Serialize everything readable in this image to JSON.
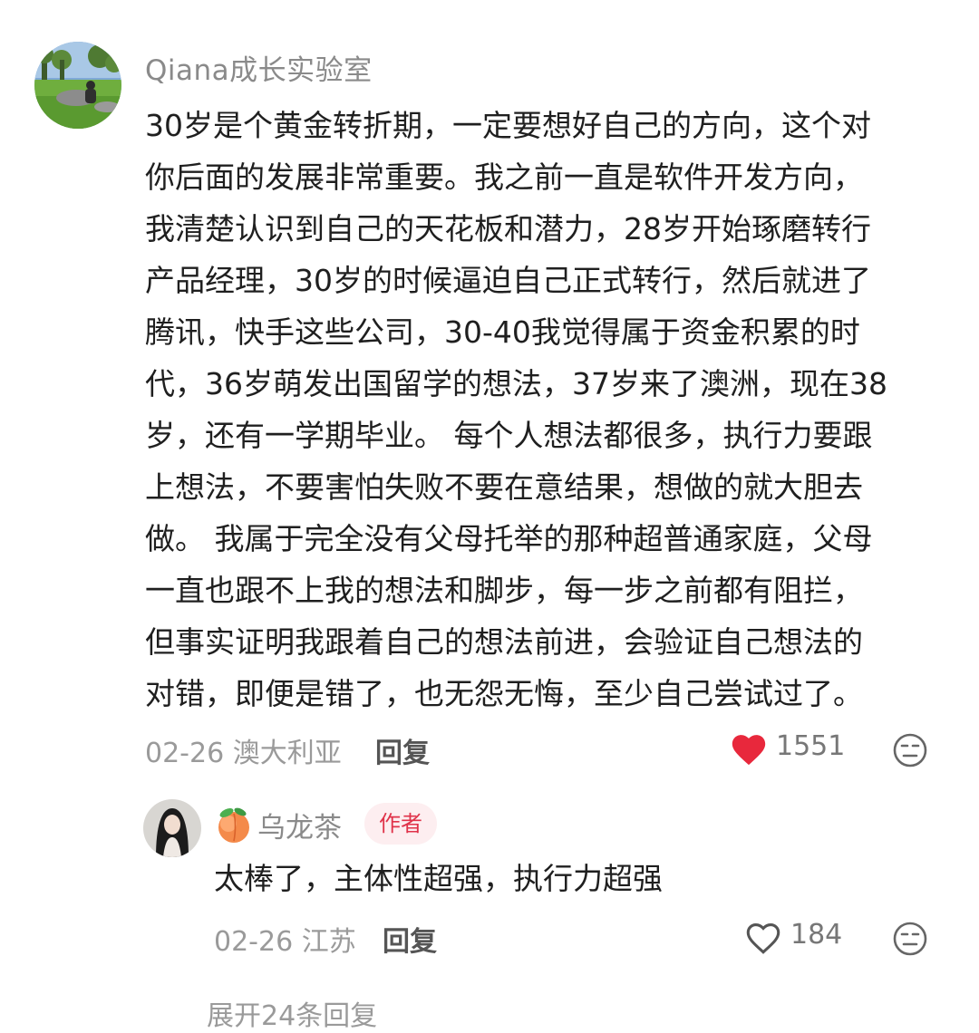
{
  "comment": {
    "username": "Qiana成长实验室",
    "body_lines": [
      "30岁是个黄金转折期，一定要想好自己的方向，这个对",
      "你后面的发展非常重要。我之前一直是软件开发方向，",
      "我清楚认识到自己的天花板和潜力，28岁开始琢磨转行",
      "产品经理，30岁的时候逼迫自己正式转行，然后就进了",
      "腾讯，快手这些公司，30-40我觉得属于资金积累的时",
      "代，36岁萌发出国留学的想法，37岁来了澳洲，现在38",
      "岁，还有一学期毕业。 每个人想法都很多，执行力要跟",
      "上想法，不要害怕失败不要在意结果，想做的就大胆去",
      "做。 我属于完全没有父母托举的那种超普通家庭，父母",
      "一直也跟不上我的想法和脚步，每一步之前都有阻拦，",
      "但事实证明我跟着自己的想法前进，会验证自己想法的",
      "对错，即便是错了，也无怨无悔，至少自己尝试过了。"
    ],
    "date": "02-26",
    "location": "澳大利亚",
    "reply_label": "回复",
    "like_count": "1551",
    "liked": true,
    "like_color": "#e8283c",
    "avatar_icon": "landscape-avatar"
  },
  "reply": {
    "username": "乌龙茶",
    "name_emoji": "peach-icon",
    "badge": "作者",
    "body": "太棒了，主体性超强，执行力超强",
    "date": "02-26",
    "location": "江苏",
    "reply_label": "回复",
    "like_count": "184",
    "liked": false,
    "avatar_icon": "person-avatar"
  },
  "expand_label": "展开24条回复"
}
